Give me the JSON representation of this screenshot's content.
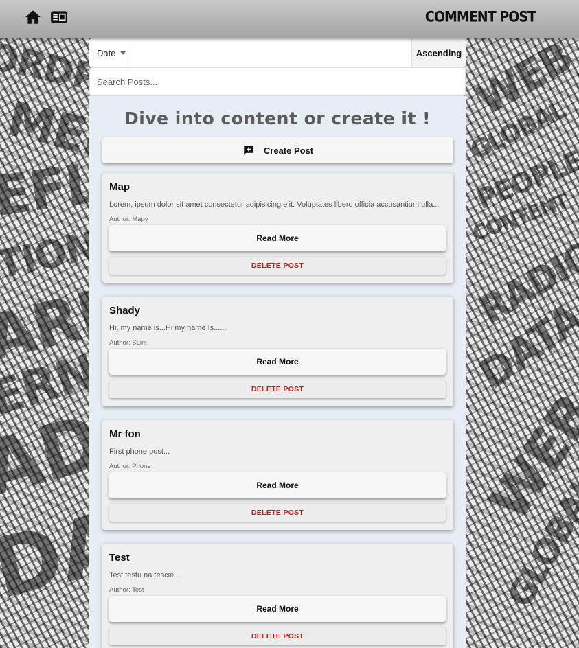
{
  "header": {
    "brand": "COMMENT POST",
    "icons": [
      "home-icon",
      "posts-icon"
    ]
  },
  "filters": {
    "sort_field": "Date",
    "sort_order": "Ascending",
    "search_placeholder": "Search Posts...",
    "search_value": ""
  },
  "main": {
    "headline": "Dive into content or create it !",
    "create_label": "Create Post",
    "posts": [
      {
        "title": "Map",
        "excerpt": "Lorem, ipsum dolor sit amet consectetur adipisicing elit. Voluptates libero officia accusantium ulla...",
        "author": "Author: Mapy",
        "read_label": "Read More",
        "delete_label": "DELETE POST"
      },
      {
        "title": "Shady",
        "excerpt": "Hi, my name is...Hi my name Is......",
        "author": "Author: SLim",
        "read_label": "Read More",
        "delete_label": "DELETE POST"
      },
      {
        "title": "Mr fon",
        "excerpt": "First phone post...",
        "author": "Author: Phone",
        "read_label": "Read More",
        "delete_label": "DELETE POST"
      },
      {
        "title": "Test",
        "excerpt": "Test testu na tescie ...",
        "author": "Author: Test",
        "read_label": "Read More",
        "delete_label": "DELETE POST"
      }
    ]
  },
  "colors": {
    "delete": "#d11a1a",
    "panel_bg": "#e7edf4",
    "header_bg": "#b3b3b3"
  }
}
